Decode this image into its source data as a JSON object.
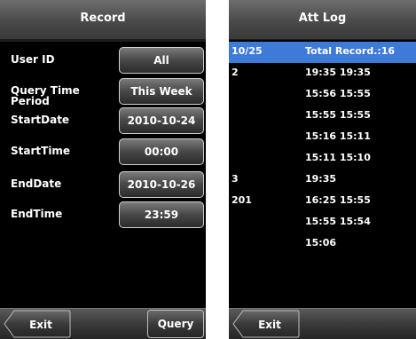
{
  "record": {
    "title": "Record",
    "fields": [
      {
        "label": "User ID",
        "value": "All"
      },
      {
        "label": "Query Time Period",
        "value": "This Week"
      },
      {
        "label": "StartDate",
        "value": "2010-10-24"
      },
      {
        "label": "StartTime",
        "value": "00:00"
      },
      {
        "label": "EndDate",
        "value": "2010-10-26"
      },
      {
        "label": "EndTime",
        "value": "23:59"
      }
    ],
    "exit_label": "Exit",
    "query_label": "Query"
  },
  "att_log": {
    "title": "Att Log",
    "rows": [
      {
        "col1": "10/25",
        "col2": "Total Record.:16",
        "selected": true
      },
      {
        "col1": "2",
        "col2": "19:35 19:35"
      },
      {
        "col1": "",
        "col2": "15:56 15:55"
      },
      {
        "col1": "",
        "col2": "15:55 15:55"
      },
      {
        "col1": "",
        "col2": "15:16 15:11"
      },
      {
        "col1": "",
        "col2": "15:11 15:10"
      },
      {
        "col1": "3",
        "col2": "19:35"
      },
      {
        "col1": "201",
        "col2": "16:25 15:55"
      },
      {
        "col1": "",
        "col2": "15:55 15:54"
      },
      {
        "col1": "",
        "col2": "15:06"
      }
    ],
    "exit_label": "Exit"
  }
}
